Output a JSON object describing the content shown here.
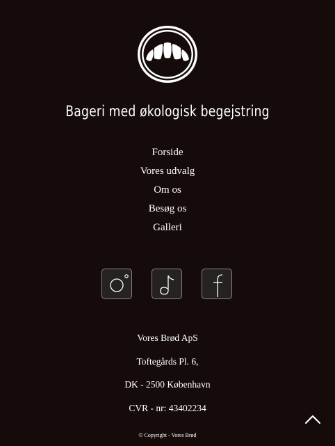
{
  "brand": {
    "tagline": "Bageri med økologisk begejstring",
    "logo_icon": "croissant-icon"
  },
  "nav": {
    "items": [
      {
        "label": "Forside"
      },
      {
        "label": "Vores udvalg"
      },
      {
        "label": "Om os"
      },
      {
        "label": "Besøg os"
      },
      {
        "label": "Galleri"
      }
    ]
  },
  "social": {
    "icons": [
      "instagram-icon",
      "tiktok-icon",
      "facebook-icon"
    ]
  },
  "address": {
    "company": "Vores Brød ApS",
    "street": "Toftegårds Pl. 6,",
    "city": "DK - 2500 København",
    "cvr": "CVR - nr: 43402234"
  },
  "footer": {
    "copyright": "© Copyright - Vores Brød"
  },
  "colors": {
    "background": "#150b0b",
    "text": "#ffffff",
    "button_border": "#8a8484"
  }
}
